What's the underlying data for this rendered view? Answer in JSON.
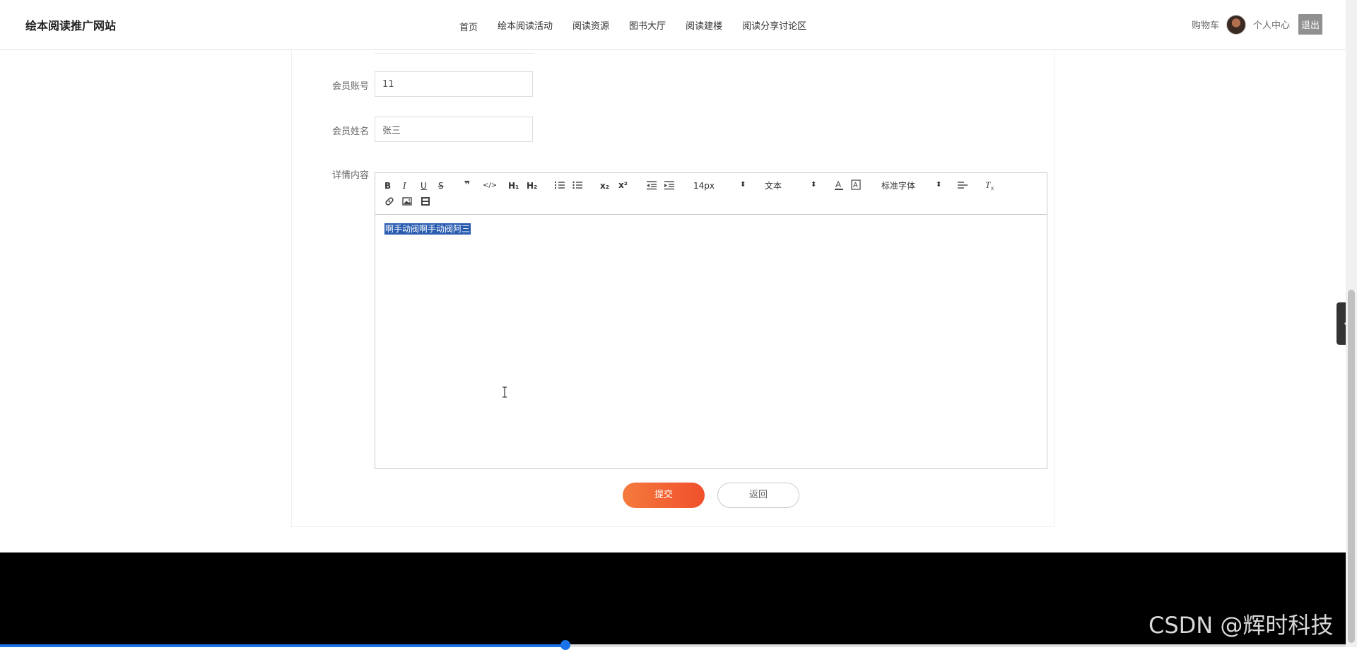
{
  "header": {
    "site_title": "绘本阅读推广网站",
    "nav": [
      "首页",
      "绘本阅读活动",
      "阅读资源",
      "图书大厅",
      "阅读建楼",
      "阅读分享讨论区"
    ],
    "cart_label": "购物车",
    "personal_center_label": "个人中心",
    "logout_label": "退出"
  },
  "form": {
    "member_account_label": "会员账号",
    "member_account_value": "11",
    "member_name_label": "会员姓名",
    "member_name_value": "张三",
    "details_label": "详情内容"
  },
  "editor": {
    "toolbar": {
      "bold": "B",
      "italic": "I",
      "underline": "U",
      "strike": "S",
      "quote": "❞",
      "code": "</>",
      "h1": "H₁",
      "h2": "H₂",
      "subscript": "x₂",
      "superscript": "x²",
      "font_size": "14px",
      "header_type": "文本",
      "font_family": "标准字体"
    },
    "content": "啊手动阀啊手动阀阿三"
  },
  "buttons": {
    "submit_label": "提交",
    "back_label": "返回"
  },
  "video_progress": 0.42,
  "watermark": "CSDN @辉时科技",
  "colors": {
    "accent_start": "#f47a3c",
    "accent_end": "#f0502c",
    "selection": "#2a5db0",
    "progress": "#1a73e8"
  }
}
